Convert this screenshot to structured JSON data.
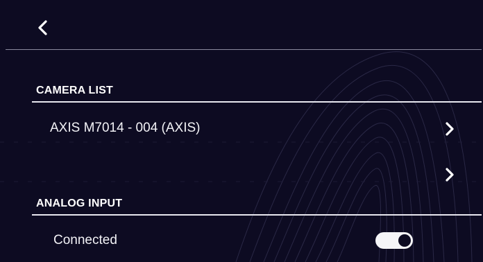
{
  "header": {
    "back_icon": "chevron-left-icon"
  },
  "camera_list": {
    "title": "CAMERA LIST",
    "items": [
      {
        "label": "AXIS M7014 - 004 (AXIS)",
        "icon": "chevron-right-icon"
      },
      {
        "label": "",
        "icon": "chevron-right-icon"
      }
    ]
  },
  "analog_input": {
    "title": "ANALOG INPUT",
    "connected_label": "Connected",
    "connected_value": true
  },
  "colors": {
    "background": "#0d0b22",
    "text": "#ffffff",
    "divider": "#e8e8f0",
    "header_rule": "#8b8a9e"
  }
}
